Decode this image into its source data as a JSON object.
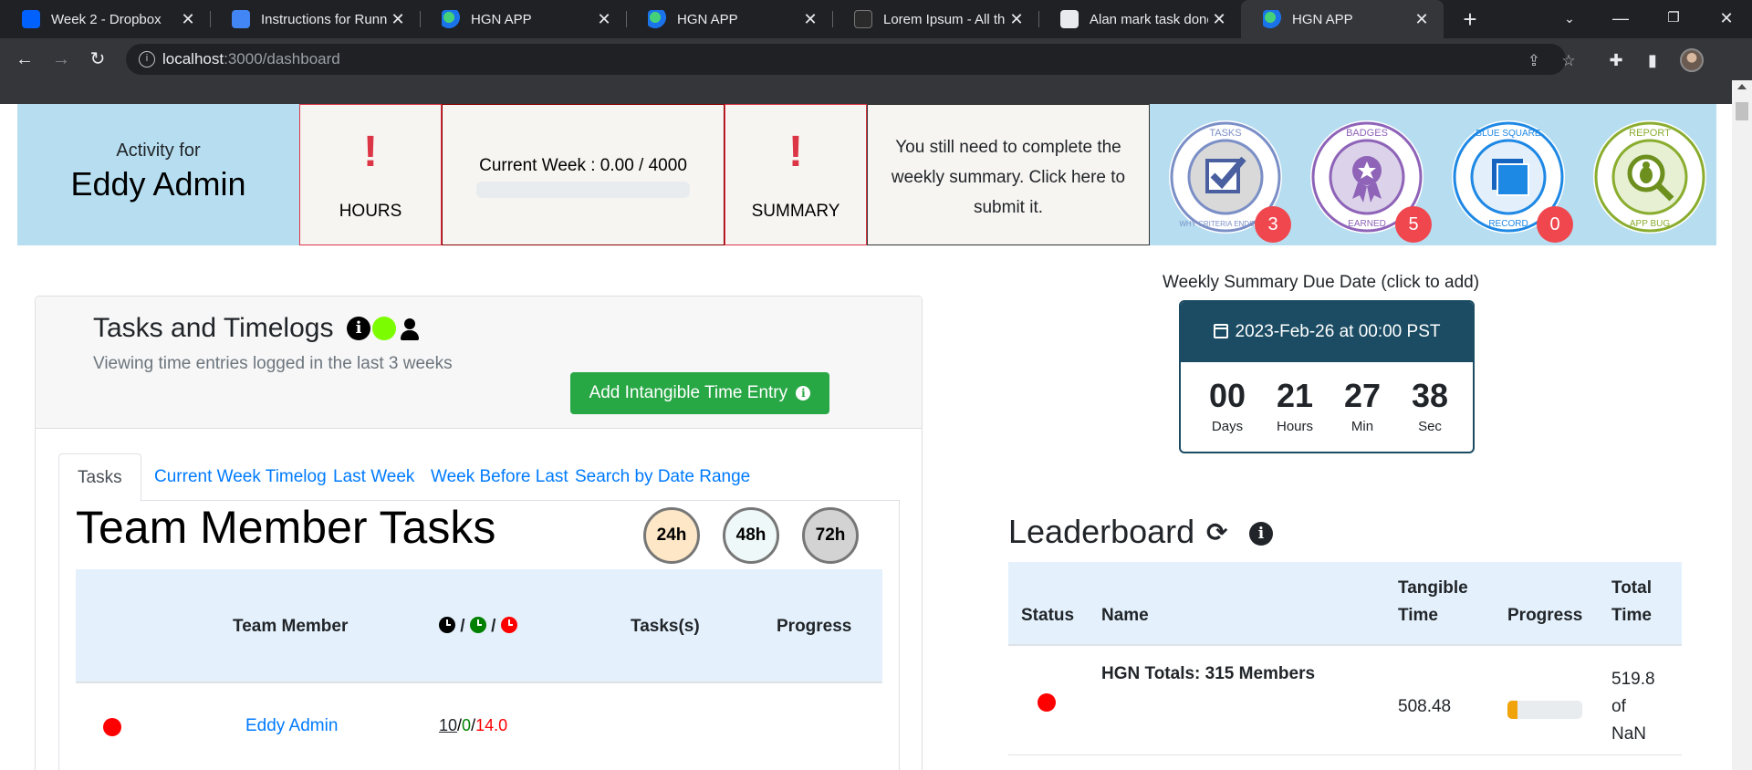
{
  "browser": {
    "tabs": [
      {
        "title": "Week 2 - Dropbox",
        "icon": "dropbox-icon"
      },
      {
        "title": "Instructions for Runnin",
        "icon": "google-docs-icon"
      },
      {
        "title": "HGN APP",
        "icon": "hgn-icon"
      },
      {
        "title": "HGN APP",
        "icon": "hgn-icon"
      },
      {
        "title": "Lorem Ipsum - All the",
        "icon": "lorem-icon"
      },
      {
        "title": "Alan mark task done c",
        "icon": "github-icon"
      },
      {
        "title": "HGN APP",
        "icon": "hgn-icon",
        "active": true
      }
    ],
    "url_host": "localhost",
    "url_path": ":3000/dashboard"
  },
  "banner": {
    "activity_for": "Activity for",
    "user_name": "Eddy Admin",
    "hours_mark": "!",
    "hours_label": "HOURS",
    "current_week": "Current Week : 0.00 / 4000",
    "current_week_progress": 0,
    "summary_mark": "!",
    "summary_label": "SUMMARY",
    "summary_notice": "You still need to complete the weekly summary. Click here to submit it.",
    "badges": [
      {
        "name": "tasks-badge",
        "top_text": "TASKS",
        "bottom_text": "WHY CRITERIA ENDSTATE",
        "count": "3",
        "color": "#7b8fc7"
      },
      {
        "name": "badges-earned-badge",
        "top_text": "BADGES",
        "bottom_text": "EARNED",
        "count": "5",
        "color": "#8e63b8"
      },
      {
        "name": "blue-square-badge",
        "top_text": "BLUE SQUARE",
        "bottom_text": "RECORD",
        "count": "0",
        "color": "#1e88e5"
      },
      {
        "name": "report-bug-badge",
        "top_text": "REPORT",
        "bottom_text": "APP BUG",
        "count": "",
        "color": "#8aad2f"
      }
    ]
  },
  "tasks_card": {
    "title": "Tasks and Timelogs",
    "subtitle": "Viewing time entries logged in the last 3 weeks",
    "add_button": "Add Intangible Time Entry",
    "tabs": [
      "Tasks",
      "Current Week Timelog",
      "Last Week",
      "Week Before Last",
      "Search by Date Range"
    ],
    "team_title": "Team Member Tasks",
    "hour_filters": [
      "24h",
      "48h",
      "72h"
    ],
    "table": {
      "headers": [
        "Team Member",
        "Tasks(s)",
        "Progress"
      ],
      "rows": [
        {
          "name": "Eddy Admin",
          "h1": "10",
          "h2": "0",
          "h3": "14.0"
        }
      ]
    }
  },
  "due_date": {
    "label": "Weekly Summary Due Date (click to add)",
    "date": "2023-Feb-26 at 00:00 PST",
    "days": "00",
    "days_label": "Days",
    "hours": "21",
    "hours_label": "Hours",
    "min": "27",
    "min_label": "Min",
    "sec": "38",
    "sec_label": "Sec"
  },
  "leaderboard": {
    "title": "Leaderboard",
    "headers": {
      "status": "Status",
      "name": "Name",
      "tangible1": "Tangible",
      "tangible2": "Time",
      "progress": "Progress",
      "total1": "Total",
      "total2": "Time"
    },
    "totals_row": {
      "name": "HGN Totals: 315 Members",
      "tangible": "508.48",
      "progress": 0.14,
      "total1": "519.8",
      "total2": "of",
      "total3": "NaN"
    }
  },
  "colors": {
    "banner_bg": "#b6def0",
    "alert": "#dc3545",
    "link": "#007bff",
    "button_green": "#28a745",
    "countdown": "#1b4c63"
  }
}
